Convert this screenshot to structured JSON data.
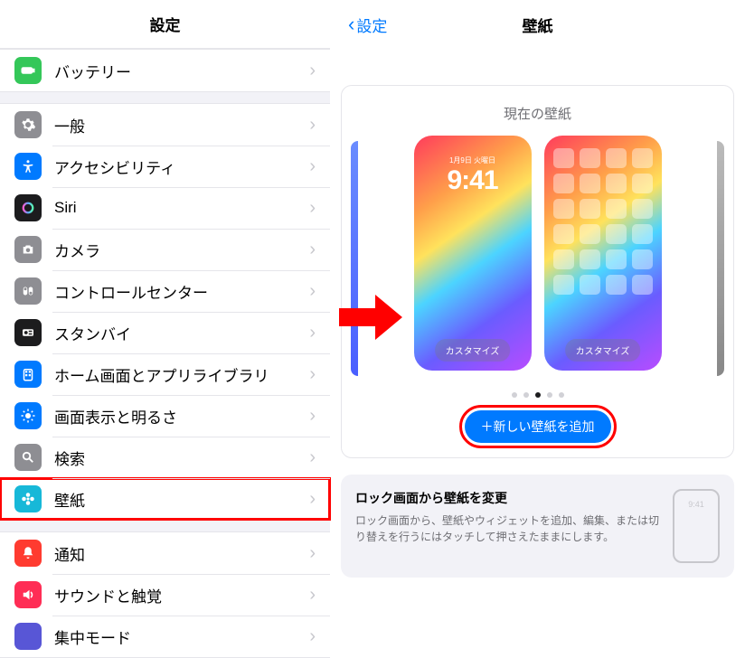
{
  "left": {
    "title": "設定",
    "groups": [
      {
        "items": [
          {
            "key": "battery",
            "label": "バッテリー"
          }
        ]
      },
      {
        "items": [
          {
            "key": "general",
            "label": "一般"
          },
          {
            "key": "accessibility",
            "label": "アクセシビリティ"
          },
          {
            "key": "siri",
            "label": "Siri"
          },
          {
            "key": "camera",
            "label": "カメラ"
          },
          {
            "key": "controlcenter",
            "label": "コントロールセンター"
          },
          {
            "key": "standby",
            "label": "スタンバイ"
          },
          {
            "key": "homescreen",
            "label": "ホーム画面とアプリライブラリ"
          },
          {
            "key": "display",
            "label": "画面表示と明るさ"
          },
          {
            "key": "search",
            "label": "検索"
          },
          {
            "key": "wallpaper",
            "label": "壁紙",
            "highlight": true
          }
        ]
      },
      {
        "items": [
          {
            "key": "notifications",
            "label": "通知"
          },
          {
            "key": "sounds",
            "label": "サウンドと触覚"
          },
          {
            "key": "focus",
            "label": "集中モード"
          }
        ]
      }
    ]
  },
  "right": {
    "back": "設定",
    "title": "壁紙",
    "current_label": "現在の壁紙",
    "lock_date": "1月9日 火曜日",
    "lock_time": "9:41",
    "customize": "カスタマイズ",
    "add_button": "＋新しい壁紙を追加",
    "info_title": "ロック画面から壁紙を変更",
    "info_body": "ロック画面から、壁紙やウィジェットを追加、編集、または切り替えを行うにはタッチして押さえたままにします。",
    "info_phone_time": "9:41"
  }
}
